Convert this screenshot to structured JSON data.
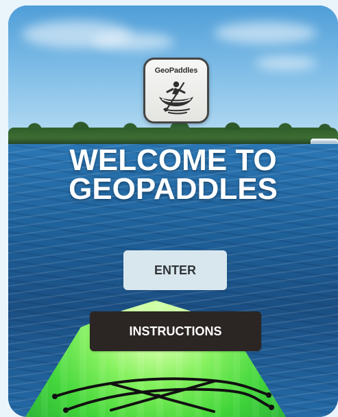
{
  "logo": {
    "brand_text": "GeoPaddles",
    "icon_name": "canoe-paddler-icon"
  },
  "hero": {
    "line1": "WELCOME TO",
    "line2": "GEOPADDLES"
  },
  "buttons": {
    "enter_label": "ENTER",
    "instructions_label": "INSTRUCTIONS"
  },
  "colors": {
    "page_background": "#eaf4fb",
    "enter_button_bg": "#d8e7ee",
    "instructions_button_bg": "#2b2523",
    "headline_text": "#ffffff"
  }
}
